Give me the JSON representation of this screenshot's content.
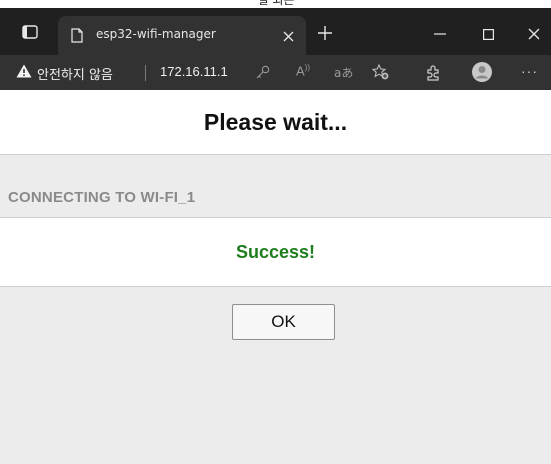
{
  "top_strip": {
    "partial_text": "잘 되는"
  },
  "tab": {
    "title": "esp32-wifi-manager"
  },
  "addressbar": {
    "security_text": "안전하지 않음",
    "url": "172.16.11.1"
  },
  "page": {
    "title": "Please wait...",
    "status": "CONNECTING TO WI-FI_1",
    "result": "Success!",
    "ok_label": "OK"
  },
  "colors": {
    "success": "#1e7d1e",
    "status_gray": "#8a8a8a",
    "chrome_dark": "#202020"
  },
  "icons": [
    "tab-actions-icon",
    "page-icon",
    "close-tab-icon",
    "new-tab-icon",
    "minimize-icon",
    "maximize-icon",
    "close-window-icon",
    "warning-icon",
    "key-icon",
    "read-aloud-icon",
    "translate-icon",
    "favorites-icon",
    "extensions-icon",
    "profile-icon",
    "more-icon"
  ]
}
